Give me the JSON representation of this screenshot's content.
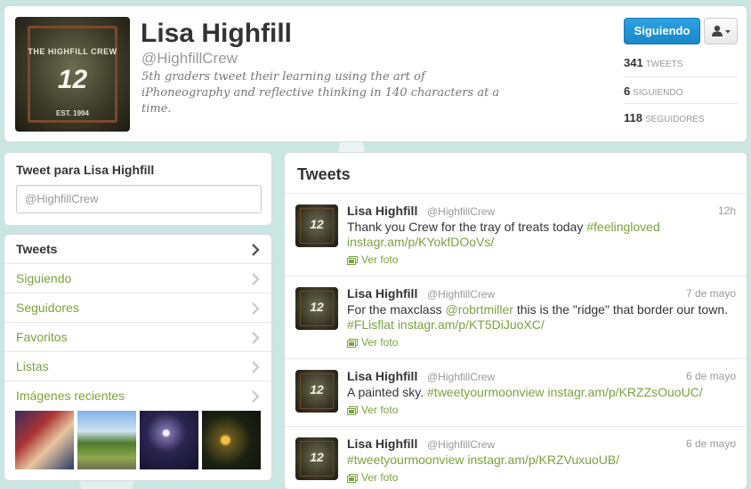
{
  "profile": {
    "name": "Lisa Highfill",
    "handle": "@HighfillCrew",
    "bio": "5th graders tweet their learning using the art of iPhoneography and reflective thinking in 140 characters at a time.",
    "avatar_text": {
      "crew": "THE HIGHFILL CREW",
      "number": "12",
      "est": "EST. 1994"
    },
    "follow_button": "Siguiendo",
    "user_menu_icon": "person-dropdown-icon",
    "stats": [
      {
        "count": "341",
        "label": "TWEETS"
      },
      {
        "count": "6",
        "label": "SIGUIENDO"
      },
      {
        "count": "118",
        "label": "SEGUIDORES"
      }
    ]
  },
  "compose": {
    "title": "Tweet para Lisa Highfill",
    "value": "@HighfillCrew"
  },
  "nav": {
    "items": [
      {
        "label": "Tweets",
        "active": true
      },
      {
        "label": "Siguiendo"
      },
      {
        "label": "Seguidores"
      },
      {
        "label": "Favoritos"
      },
      {
        "label": "Listas"
      },
      {
        "label": "Imágenes recientes"
      }
    ]
  },
  "timeline": {
    "title": "Tweets",
    "photo_label": "Ver foto",
    "tweets": [
      {
        "name": "Lisa Highfill",
        "handle": "@HighfillCrew",
        "time": "12h",
        "text_plain": "Thank you Crew for the tray of treats today ",
        "hashtag": "#feelingloved",
        "link": "instagr.am/p/KYokfDOoVs/"
      },
      {
        "name": "Lisa Highfill",
        "handle": "@HighfillCrew",
        "time": "7 de mayo",
        "text_a": "For the maxclass ",
        "mention": "@robrtmiller",
        "text_b": " this is the \"ridge\" that border our town.",
        "hashtag": "#FLisflat",
        "link": "instagr.am/p/KT5DiJuoXC/"
      },
      {
        "name": "Lisa Highfill",
        "handle": "@HighfillCrew",
        "time": "6 de mayo",
        "text_plain": "A painted sky. ",
        "hashtag": "#tweetyourmoonview",
        "link": "instagr.am/p/KRZZsOuoUC/"
      },
      {
        "name": "Lisa Highfill",
        "handle": "@HighfillCrew",
        "time": "6 de mayo",
        "hashtag": "#tweetyourmoonview",
        "link": "instagr.am/p/KRZVuxuoUB/"
      }
    ]
  },
  "colors": {
    "background": "#c9e6e2",
    "link_green": "#7aa23d",
    "follow_blue": "#1a87c9"
  }
}
